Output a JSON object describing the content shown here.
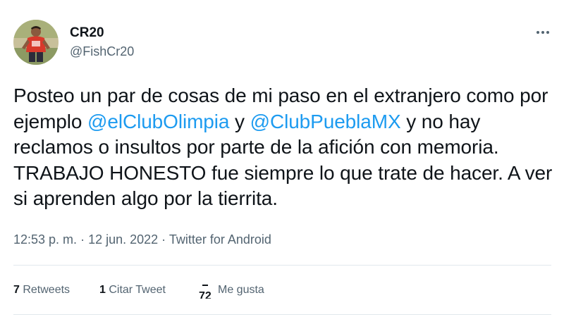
{
  "user": {
    "name": "CR20",
    "handle": "@FishCr20"
  },
  "tweet": {
    "text_part1": "Posteo un par de cosas de mi paso en el extranjero como por ejemplo ",
    "mention1": "@elClubOlimpia",
    "text_part2": " y ",
    "mention2": "@ClubPueblaMX",
    "text_part3": " y no hay reclamos o insultos por parte de la afición con memoria. TRABAJO HONESTO fue siempre lo que trate de hacer. A ver si aprenden algo por la tierrita."
  },
  "meta": {
    "time": "12:53 p. m.",
    "separator1": " · ",
    "date": "12 jun. 2022",
    "separator2": " · ",
    "source": "Twitter for Android"
  },
  "stats": {
    "retweets_count": "7",
    "retweets_label": " Retweets",
    "quotes_count": "1",
    "quotes_label": " Citar Tweet",
    "likes_count": "72",
    "likes_label": "Me gusta"
  },
  "icons": {
    "more": "more-dots-icon"
  },
  "colors": {
    "link": "#1d9bf0",
    "secondary_text": "#536471",
    "primary_text": "#0f1419",
    "divider": "#e1e8ed"
  }
}
